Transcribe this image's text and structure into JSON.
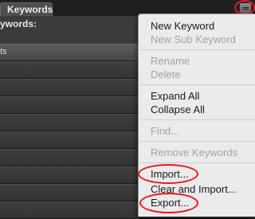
{
  "panel": {
    "tab_label": "Keywords",
    "field_label": "ywords:",
    "menu_button_icon": "panel-menu-icon",
    "rows": [
      {
        "label": "ts",
        "kind": "header"
      },
      {
        "label": "",
        "kind": "row"
      },
      {
        "label": "",
        "kind": "row"
      },
      {
        "label": "",
        "kind": "row"
      },
      {
        "label": "",
        "kind": "row"
      },
      {
        "label": "",
        "kind": "row"
      },
      {
        "label": "",
        "kind": "row"
      },
      {
        "label": "",
        "kind": "row"
      },
      {
        "label": "",
        "kind": "row"
      },
      {
        "label": "",
        "kind": "row"
      }
    ]
  },
  "menu": {
    "new_keyword": "New Keyword",
    "new_sub_keyword": "New Sub Keyword",
    "rename": "Rename",
    "delete": "Delete",
    "expand_all": "Expand All",
    "collapse_all": "Collapse All",
    "find": "Find...",
    "remove_keywords": "Remove Keywords",
    "import": "Import...",
    "clear_and_import": "Clear and Import...",
    "export": "Export..."
  },
  "annotation_color": "#e8161b"
}
